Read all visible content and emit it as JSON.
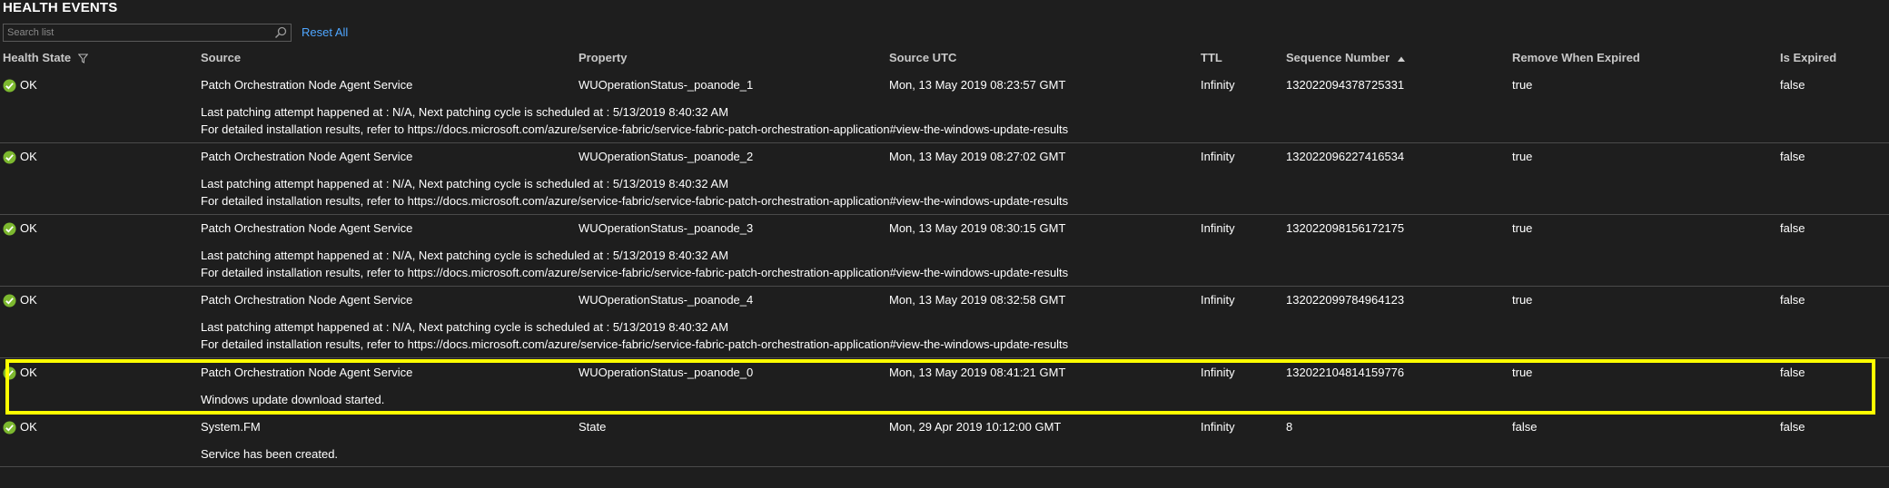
{
  "panel": {
    "title": "HEALTH EVENTS",
    "search_placeholder": "Search list",
    "reset_label": "Reset All"
  },
  "columns": {
    "health_state": "Health State",
    "source": "Source",
    "property": "Property",
    "source_utc": "Source UTC",
    "ttl": "TTL",
    "sequence_number": "Sequence Number",
    "remove_when_expired": "Remove When Expired",
    "is_expired": "Is Expired"
  },
  "rows": [
    {
      "state": "OK",
      "source": "Patch Orchestration Node Agent Service",
      "property": "WUOperationStatus-_poanode_1",
      "source_utc": "Mon, 13 May 2019 08:23:57 GMT",
      "ttl": "Infinity",
      "sequence": "132022094378725331",
      "remove": "true",
      "expired": "false",
      "desc1": "Last patching attempt happened at : N/A, Next patching cycle is scheduled at : 5/13/2019 8:40:32 AM",
      "desc2": "For detailed installation results, refer to https://docs.microsoft.com/azure/service-fabric/service-fabric-patch-orchestration-application#view-the-windows-update-results"
    },
    {
      "state": "OK",
      "source": "Patch Orchestration Node Agent Service",
      "property": "WUOperationStatus-_poanode_2",
      "source_utc": "Mon, 13 May 2019 08:27:02 GMT",
      "ttl": "Infinity",
      "sequence": "132022096227416534",
      "remove": "true",
      "expired": "false",
      "desc1": "Last patching attempt happened at : N/A, Next patching cycle is scheduled at : 5/13/2019 8:40:32 AM",
      "desc2": "For detailed installation results, refer to https://docs.microsoft.com/azure/service-fabric/service-fabric-patch-orchestration-application#view-the-windows-update-results"
    },
    {
      "state": "OK",
      "source": "Patch Orchestration Node Agent Service",
      "property": "WUOperationStatus-_poanode_3",
      "source_utc": "Mon, 13 May 2019 08:30:15 GMT",
      "ttl": "Infinity",
      "sequence": "132022098156172175",
      "remove": "true",
      "expired": "false",
      "desc1": "Last patching attempt happened at : N/A, Next patching cycle is scheduled at : 5/13/2019 8:40:32 AM",
      "desc2": "For detailed installation results, refer to https://docs.microsoft.com/azure/service-fabric/service-fabric-patch-orchestration-application#view-the-windows-update-results"
    },
    {
      "state": "OK",
      "source": "Patch Orchestration Node Agent Service",
      "property": "WUOperationStatus-_poanode_4",
      "source_utc": "Mon, 13 May 2019 08:32:58 GMT",
      "ttl": "Infinity",
      "sequence": "132022099784964123",
      "remove": "true",
      "expired": "false",
      "desc1": "Last patching attempt happened at : N/A, Next patching cycle is scheduled at : 5/13/2019 8:40:32 AM",
      "desc2": "For detailed installation results, refer to https://docs.microsoft.com/azure/service-fabric/service-fabric-patch-orchestration-application#view-the-windows-update-results"
    },
    {
      "state": "OK",
      "source": "Patch Orchestration Node Agent Service",
      "property": "WUOperationStatus-_poanode_0",
      "source_utc": "Mon, 13 May 2019 08:41:21 GMT",
      "ttl": "Infinity",
      "sequence": "132022104814159776",
      "remove": "true",
      "expired": "false",
      "desc1": "Windows update download started."
    },
    {
      "state": "OK",
      "source": "System.FM",
      "property": "State",
      "source_utc": "Mon, 29 Apr 2019 10:12:00 GMT",
      "ttl": "Infinity",
      "sequence": "8",
      "remove": "false",
      "expired": "false",
      "desc1": "Service has been created."
    }
  ],
  "colors": {
    "background": "#1e1e1e",
    "link": "#4fa6ff",
    "ok": "#7cb82f",
    "highlight": "#ffff00"
  }
}
